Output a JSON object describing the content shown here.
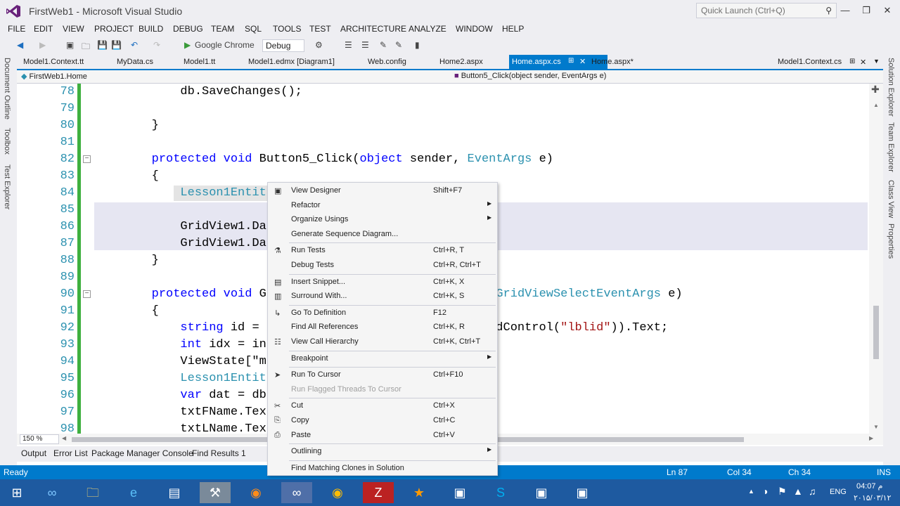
{
  "window": {
    "title": "FirstWeb1 - Microsoft Visual Studio",
    "quick_launch_placeholder": "Quick Launch (Ctrl+Q)"
  },
  "menu": [
    "FILE",
    "EDIT",
    "VIEW",
    "PROJECT",
    "BUILD",
    "DEBUG",
    "TEAM",
    "SQL",
    "TOOLS",
    "TEST",
    "ARCHITECTURE",
    "ANALYZE",
    "WINDOW",
    "HELP"
  ],
  "toolbar": {
    "browser": "Google Chrome",
    "config": "Debug"
  },
  "left_panels": [
    "Document Outline",
    "Toolbox",
    "Test Explorer"
  ],
  "right_panels": [
    "Solution Explorer",
    "Team Explorer",
    "Class View",
    "Properties"
  ],
  "tabs": [
    "Model1.Context.tt",
    "MyData.cs",
    "Model1.tt",
    "Model1.edmx [Diagram1]",
    "Web.config",
    "Home2.aspx",
    "Home.aspx.cs",
    "Home.aspx*",
    "Model1.Context.cs"
  ],
  "active_tab": "Home.aspx.cs",
  "nav": {
    "class": "FirstWeb1.Home",
    "member": "Button5_Click(object sender, EventArgs e)"
  },
  "code_lines": [
    {
      "n": "78",
      "t": "            db.SaveChanges();"
    },
    {
      "n": "79",
      "t": ""
    },
    {
      "n": "80",
      "t": "        }"
    },
    {
      "n": "81",
      "t": ""
    },
    {
      "n": "82",
      "t": "        protected void Button5_Click(object sender, EventArgs e)"
    },
    {
      "n": "83",
      "t": "        {"
    },
    {
      "n": "84",
      "t": "            Lesson1Entit"
    },
    {
      "n": "85",
      "t": ""
    },
    {
      "n": "86",
      "t": "            GridView1.Da"
    },
    {
      "n": "87",
      "t": "            GridView1.Da"
    },
    {
      "n": "88",
      "t": "        }"
    },
    {
      "n": "89",
      "t": ""
    },
    {
      "n": "90",
      "t": "        protected void G                 object sender, GridViewSelectEventArgs e)"
    },
    {
      "n": "91",
      "t": "        {"
    },
    {
      "n": "92",
      "t": "            string id =                  ectedIndex].FindControl(\"lblid\")).Text;"
    },
    {
      "n": "93",
      "t": "            int idx = in"
    },
    {
      "n": "94",
      "t": "            ViewState[\"m"
    },
    {
      "n": "95",
      "t": "            Lesson1Entit"
    },
    {
      "n": "96",
      "t": "            var dat = db                 dx);"
    },
    {
      "n": "97",
      "t": "            txtFName.Tex"
    },
    {
      "n": "98",
      "t": "            txtLName.Tex"
    }
  ],
  "zoom": "150 %",
  "bottom_tabs": [
    "Output",
    "Error List",
    "Package Manager Console",
    "Find Results 1"
  ],
  "status": {
    "left": "Ready",
    "ln": "Ln 87",
    "col": "Col 34",
    "ch": "Ch 34",
    "mode": "INS"
  },
  "context_menu": [
    {
      "label": "View Designer",
      "shortcut": "Shift+F7",
      "icon": "designer-icon"
    },
    {
      "label": "Refactor",
      "submenu": true
    },
    {
      "label": "Organize Usings",
      "submenu": true
    },
    {
      "label": "Generate Sequence Diagram..."
    },
    {
      "sep": true
    },
    {
      "label": "Run Tests",
      "shortcut": "Ctrl+R, T",
      "icon": "flask-icon"
    },
    {
      "label": "Debug Tests",
      "shortcut": "Ctrl+R, Ctrl+T"
    },
    {
      "sep": true
    },
    {
      "label": "Insert Snippet...",
      "shortcut": "Ctrl+K, X",
      "icon": "snippet-icon"
    },
    {
      "label": "Surround With...",
      "shortcut": "Ctrl+K, S",
      "icon": "surround-icon"
    },
    {
      "sep": true
    },
    {
      "label": "Go To Definition",
      "shortcut": "F12",
      "icon": "goto-icon"
    },
    {
      "label": "Find All References",
      "shortcut": "Ctrl+K, R"
    },
    {
      "label": "View Call Hierarchy",
      "shortcut": "Ctrl+K, Ctrl+T",
      "icon": "hierarchy-icon"
    },
    {
      "sep": true
    },
    {
      "label": "Breakpoint",
      "submenu": true
    },
    {
      "sep": true
    },
    {
      "label": "Run To Cursor",
      "shortcut": "Ctrl+F10",
      "icon": "cursor-icon"
    },
    {
      "label": "Run Flagged Threads To Cursor",
      "disabled": true
    },
    {
      "sep": true
    },
    {
      "label": "Cut",
      "shortcut": "Ctrl+X",
      "icon": "scissors-icon"
    },
    {
      "label": "Copy",
      "shortcut": "Ctrl+C",
      "icon": "copy-icon"
    },
    {
      "label": "Paste",
      "shortcut": "Ctrl+V",
      "icon": "paste-icon"
    },
    {
      "sep": true
    },
    {
      "label": "Outlining",
      "submenu": true
    },
    {
      "sep": true
    },
    {
      "label": "Find Matching Clones in Solution"
    }
  ],
  "clock": {
    "time": "04:07 م",
    "date": "۲۰۱۵/۰۳/۱۲"
  },
  "lang": "ENG"
}
